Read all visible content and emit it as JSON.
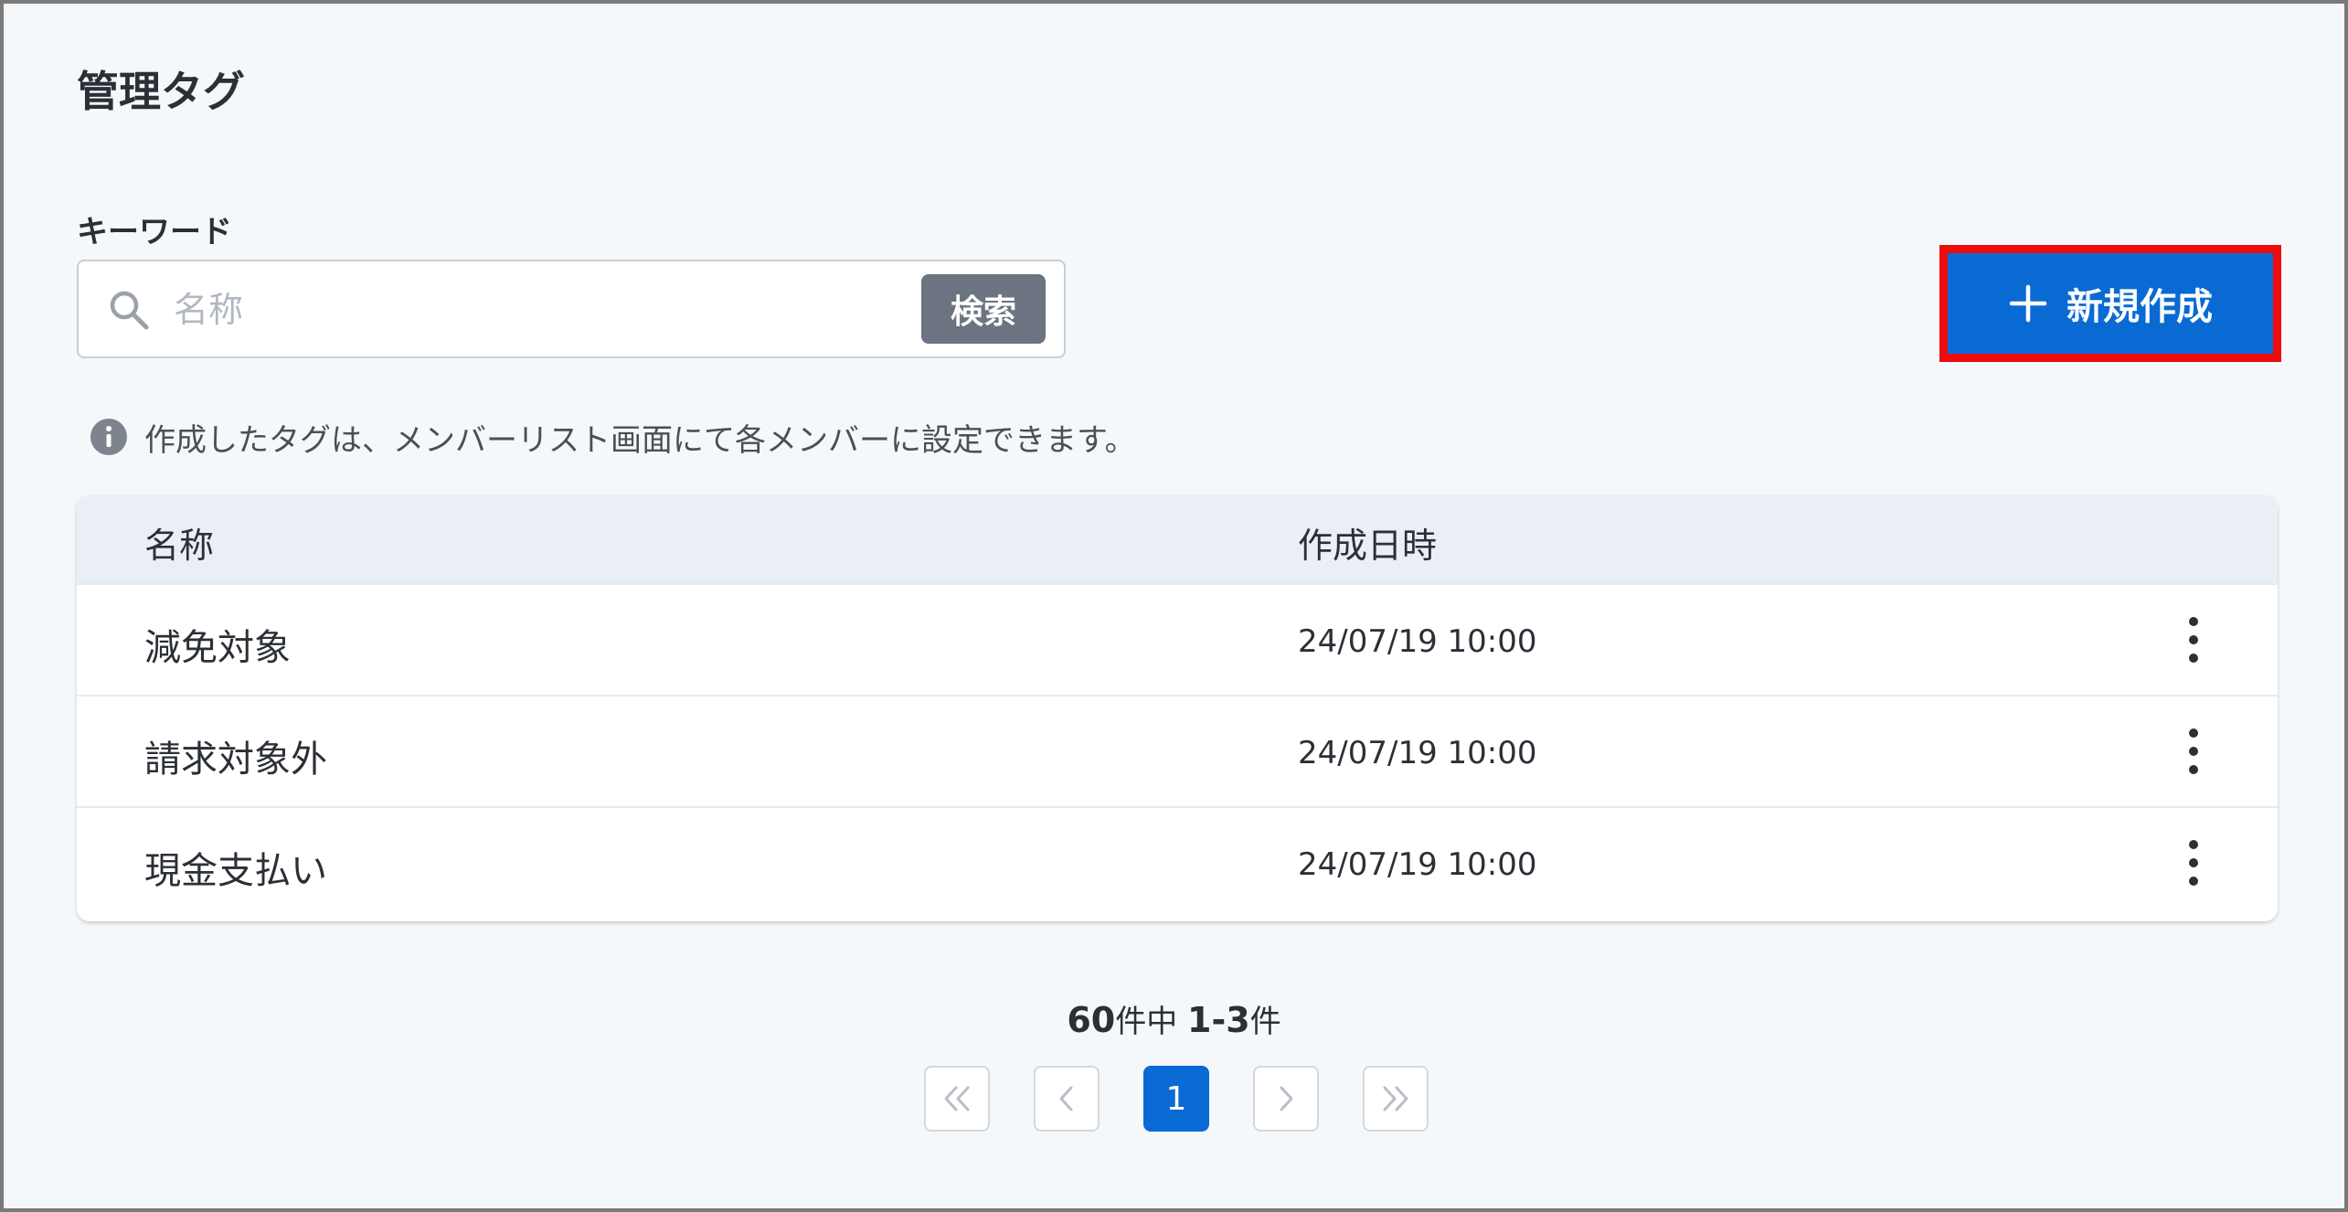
{
  "page": {
    "title": "管理タグ"
  },
  "search": {
    "label": "キーワード",
    "placeholder": "名称",
    "value": "",
    "button_label": "検索"
  },
  "actions": {
    "new_label": "新規作成"
  },
  "info": {
    "text": "作成したタグは、メンバーリスト画面にて各メンバーに設定できます。"
  },
  "table": {
    "columns": [
      "名称",
      "作成日時"
    ],
    "rows": [
      {
        "name": "減免対象",
        "created_at": "24/07/19 10:00"
      },
      {
        "name": "請求対象外",
        "created_at": "24/07/19 10:00"
      },
      {
        "name": "現金支払い",
        "created_at": "24/07/19 10:00"
      }
    ]
  },
  "pagination": {
    "total": "60",
    "total_suffix": "件中",
    "range": "1-3",
    "range_suffix": "件",
    "current_page": "1"
  },
  "colors": {
    "accent": "#0a6ad4",
    "highlight_border": "#ee0b0b",
    "search_button": "#6b7480",
    "table_header": "#eaeff6",
    "background": "#f5f8fb"
  },
  "icons": {
    "search": "search-icon",
    "plus": "plus-icon",
    "info": "info-icon",
    "row_menu": "more-vertical-icon",
    "first": "double-chevron-left-icon",
    "prev": "chevron-left-icon",
    "next": "chevron-right-icon",
    "last": "double-chevron-right-icon"
  }
}
